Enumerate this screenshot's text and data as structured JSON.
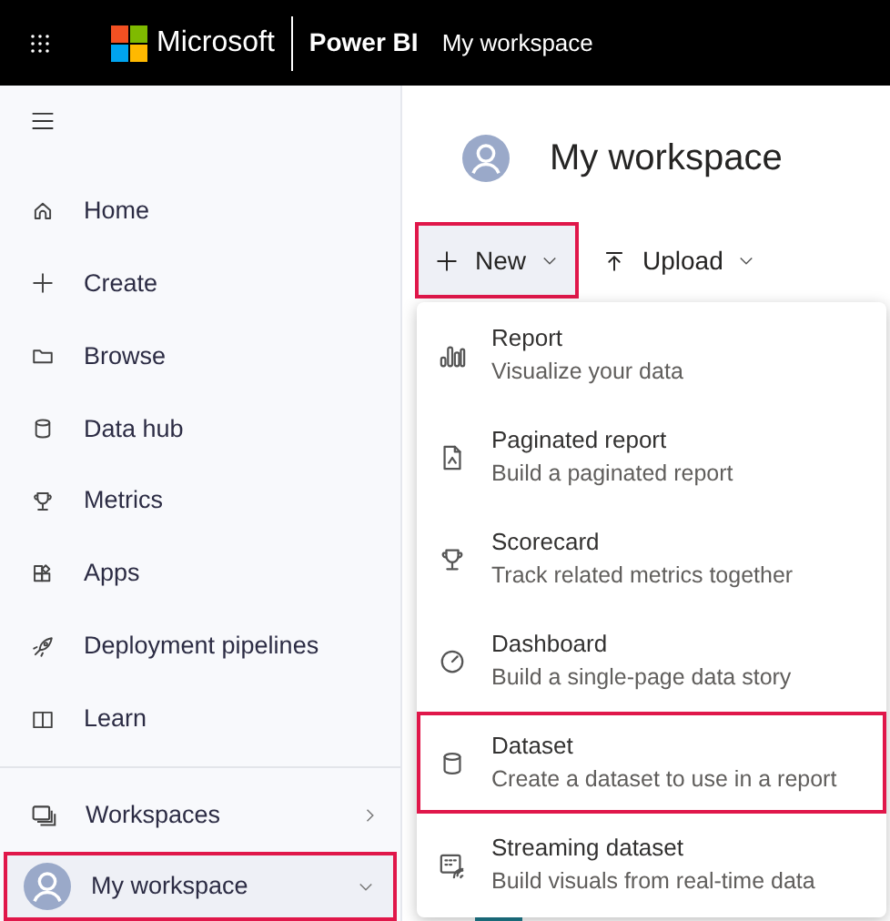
{
  "top_bar": {
    "brand": "Microsoft",
    "product": "Power BI",
    "location": "My workspace"
  },
  "sidebar": {
    "items": [
      {
        "label": "Home"
      },
      {
        "label": "Create"
      },
      {
        "label": "Browse"
      },
      {
        "label": "Data hub"
      },
      {
        "label": "Metrics"
      },
      {
        "label": "Apps"
      },
      {
        "label": "Deployment pipelines"
      },
      {
        "label": "Learn"
      }
    ],
    "workspaces": {
      "label": "Workspaces"
    },
    "current": {
      "label": "My workspace",
      "highlighted": true
    }
  },
  "header": {
    "title": "My workspace"
  },
  "toolbar": [
    {
      "label": "New",
      "highlighted": true
    },
    {
      "label": "Upload",
      "highlighted": false
    }
  ],
  "new_menu": [
    {
      "title": "Report",
      "description": "Visualize your data",
      "highlighted": false
    },
    {
      "title": "Paginated report",
      "description": "Build a paginated report",
      "highlighted": false
    },
    {
      "title": "Scorecard",
      "description": "Track related metrics together",
      "highlighted": false
    },
    {
      "title": "Dashboard",
      "description": "Build a single-page data story",
      "highlighted": false
    },
    {
      "title": "Dataset",
      "description": "Create a dataset to use in a report",
      "highlighted": true
    },
    {
      "title": "Streaming dataset",
      "description": "Build visuals from real-time data",
      "highlighted": false
    }
  ]
}
